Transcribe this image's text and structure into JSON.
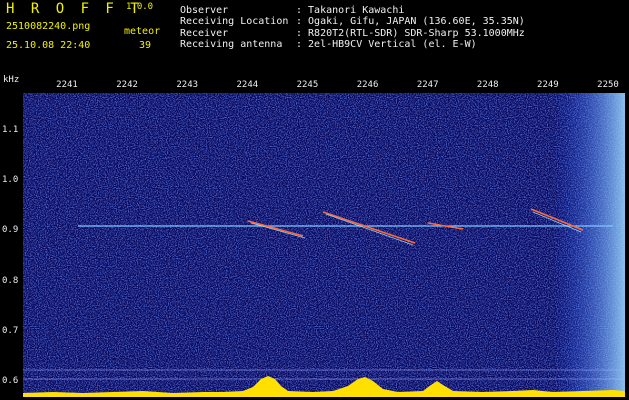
{
  "header": {
    "title": "H R O F F T",
    "version": "1.0.0",
    "filename": "2510082240.png",
    "datetime": "25.10.08 22:40",
    "type_label": "meteor",
    "count": "39",
    "fields": [
      {
        "label": "Observer",
        "value": ": Takanori Kawachi"
      },
      {
        "label": "Receiving Location",
        "value": ": Ogaki, Gifu, JAPAN (136.60E, 35.35N)"
      },
      {
        "label": "Receiver",
        "value": ": R820T2(RTL-SDR) SDR-Sharp 53.1000MHz"
      },
      {
        "label": "Receiving antenna",
        "value": ": 2el-HB9CV Vertical (el. E-W)"
      }
    ]
  },
  "axis": {
    "unit": "kHz",
    "time_ticks": [
      "2241",
      "2242",
      "2243",
      "2244",
      "2245",
      "2246",
      "2247",
      "2248",
      "2249",
      "2250"
    ],
    "freq_ticks": [
      "1.1",
      "1.0",
      "0.9",
      "0.8",
      "0.7",
      "0.6"
    ]
  },
  "colors": {
    "text_yellow": "#f2f200",
    "text_white": "#f0f0f0",
    "background_noise": "#0a0a6a",
    "carrier_line": "#7ec8ff",
    "meteor_echo": "#ff6a3a",
    "power_trace": "#ffe000"
  }
}
